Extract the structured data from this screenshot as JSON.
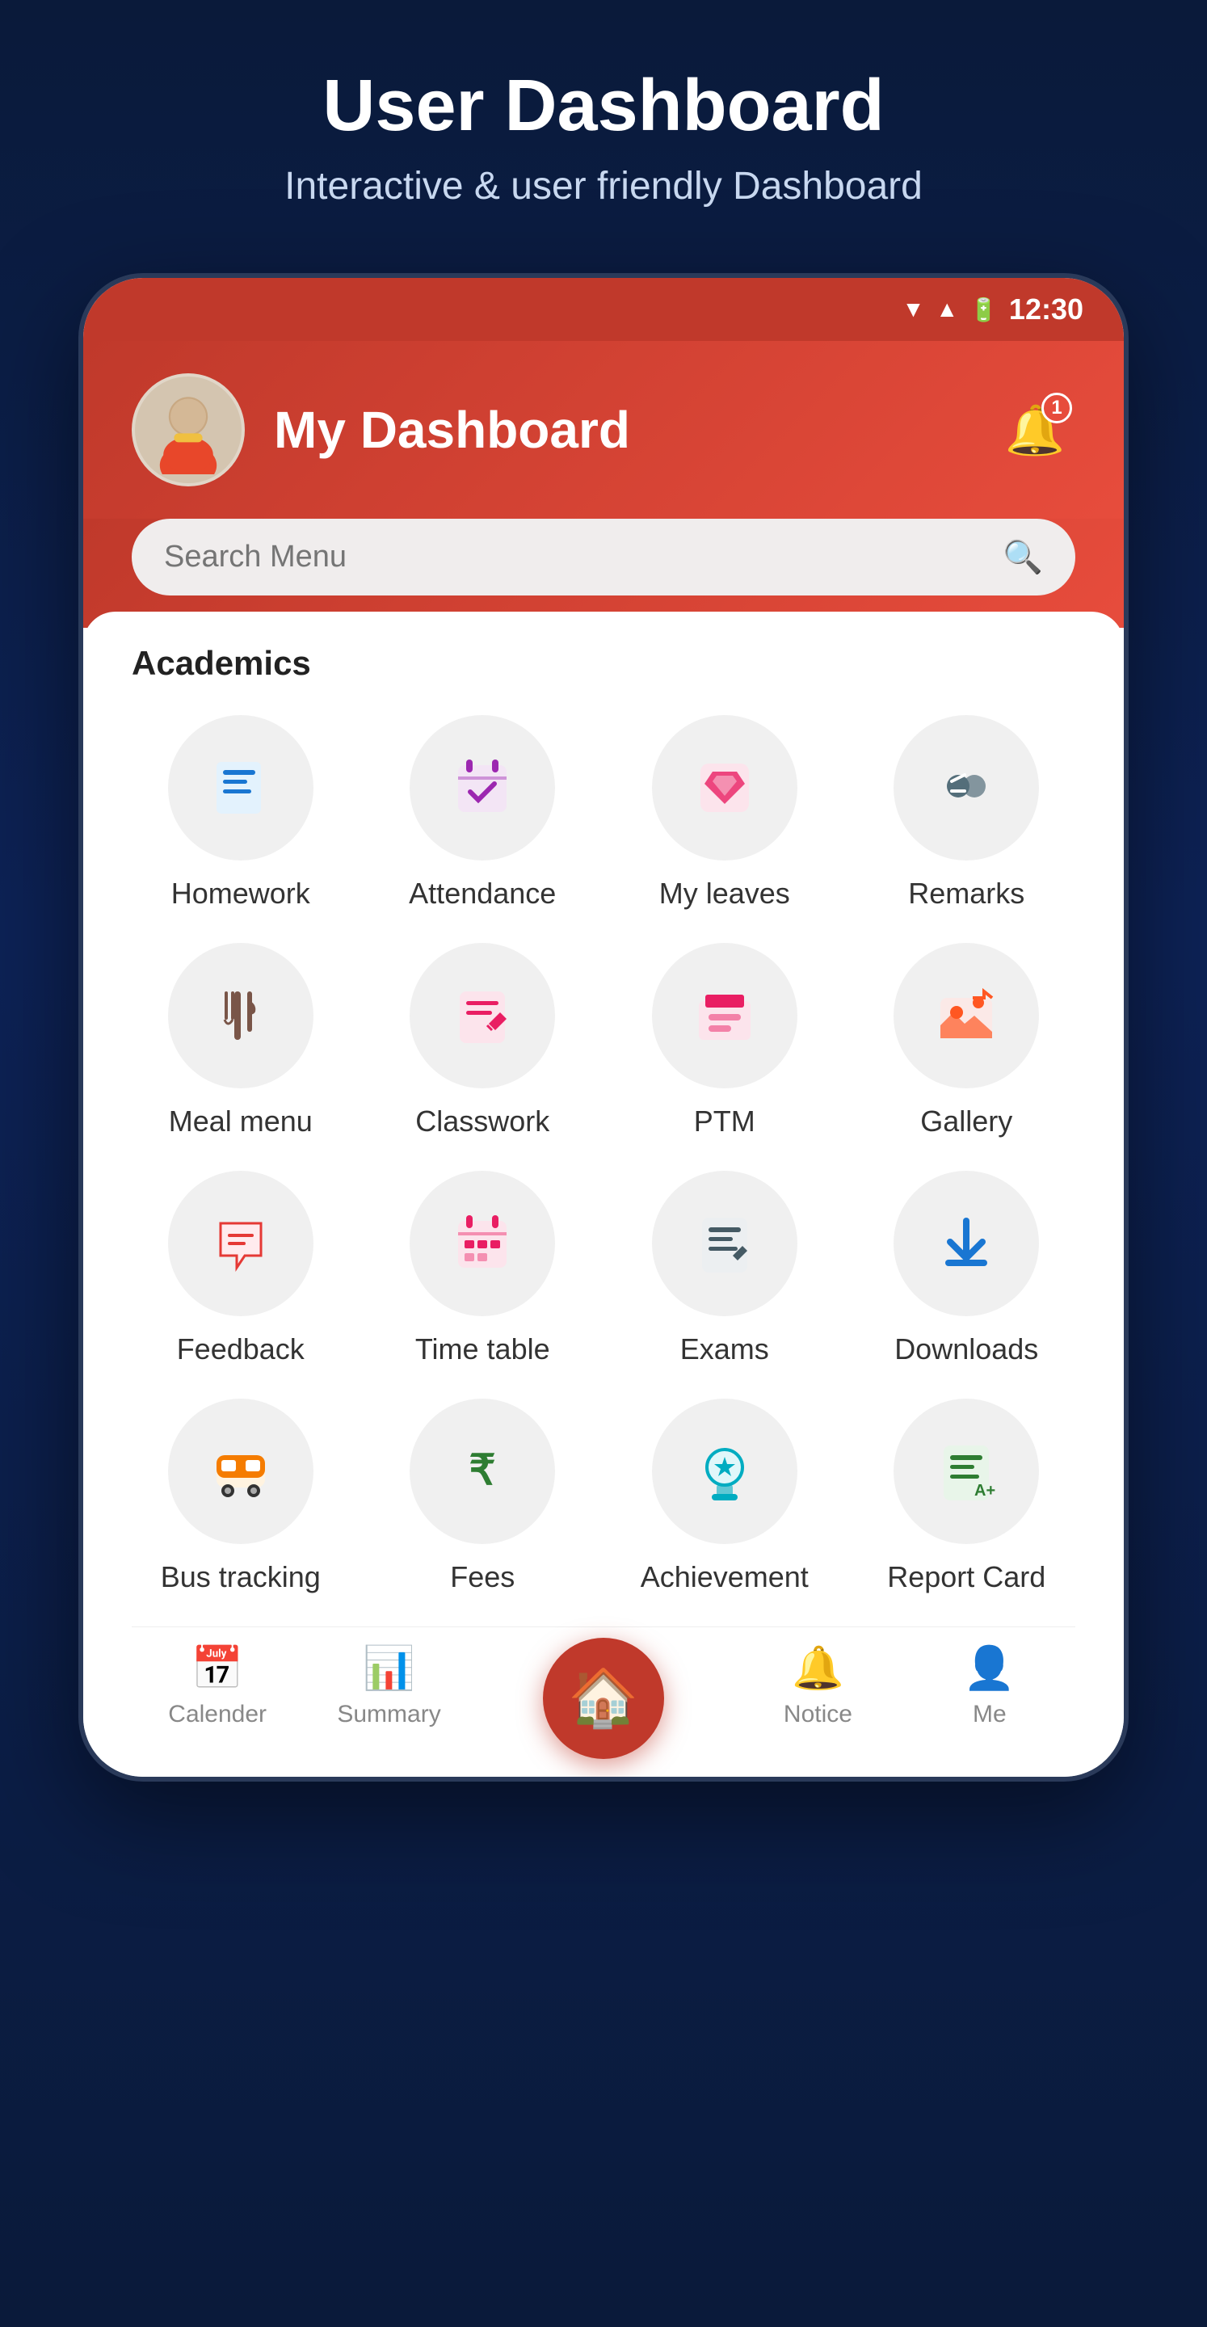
{
  "header": {
    "title": "User Dashboard",
    "subtitle": "Interactive & user friendly Dashboard"
  },
  "statusBar": {
    "time": "12:30"
  },
  "appHeader": {
    "dashboardTitle": "My Dashboard",
    "notificationCount": "1"
  },
  "search": {
    "placeholder": "Search Menu"
  },
  "sections": {
    "academics": {
      "label": "Academics"
    }
  },
  "menuItems": [
    {
      "id": "homework",
      "label": "Homework",
      "icon": "📄",
      "colorClass": "ic-homework"
    },
    {
      "id": "attendance",
      "label": "Attendance",
      "icon": "✅",
      "colorClass": "ic-attendance"
    },
    {
      "id": "my-leaves",
      "label": "My leaves",
      "icon": "🔄",
      "colorClass": "ic-leaves"
    },
    {
      "id": "remarks",
      "label": "Remarks",
      "icon": "👍",
      "colorClass": "ic-remarks"
    },
    {
      "id": "meal-menu",
      "label": "Meal menu",
      "icon": "🍽️",
      "colorClass": "ic-meal"
    },
    {
      "id": "classwork",
      "label": "Classwork",
      "icon": "📝",
      "colorClass": "ic-classwork"
    },
    {
      "id": "ptm",
      "label": "PTM",
      "icon": "🗂️",
      "colorClass": "ic-ptm"
    },
    {
      "id": "gallery",
      "label": "Gallery",
      "icon": "📷",
      "colorClass": "ic-gallery"
    },
    {
      "id": "feedback",
      "label": "Feedback",
      "icon": "💬",
      "colorClass": "ic-feedback"
    },
    {
      "id": "time-table",
      "label": "Time table",
      "icon": "📅",
      "colorClass": "ic-timetable"
    },
    {
      "id": "exams",
      "label": "Exams",
      "icon": "📋",
      "colorClass": "ic-exams"
    },
    {
      "id": "downloads",
      "label": "Downloads",
      "icon": "⬇️",
      "colorClass": "ic-downloads"
    },
    {
      "id": "bus-tracking",
      "label": "Bus tracking",
      "icon": "🚌",
      "colorClass": "ic-bus"
    },
    {
      "id": "fees",
      "label": "Fees",
      "icon": "₹",
      "colorClass": "ic-fees"
    },
    {
      "id": "achievement",
      "label": "Achievement",
      "icon": "🏅",
      "colorClass": "ic-achievement"
    },
    {
      "id": "report-card",
      "label": "Report Card",
      "icon": "📄",
      "colorClass": "ic-reportcard"
    }
  ],
  "bottomNav": [
    {
      "id": "calender",
      "label": "Calender",
      "icon": "📅"
    },
    {
      "id": "summary",
      "label": "Summary",
      "icon": "📊"
    },
    {
      "id": "home",
      "label": "",
      "icon": "🏠"
    },
    {
      "id": "notice",
      "label": "Notice",
      "icon": "🔔"
    },
    {
      "id": "me",
      "label": "Me",
      "icon": "👤"
    }
  ]
}
